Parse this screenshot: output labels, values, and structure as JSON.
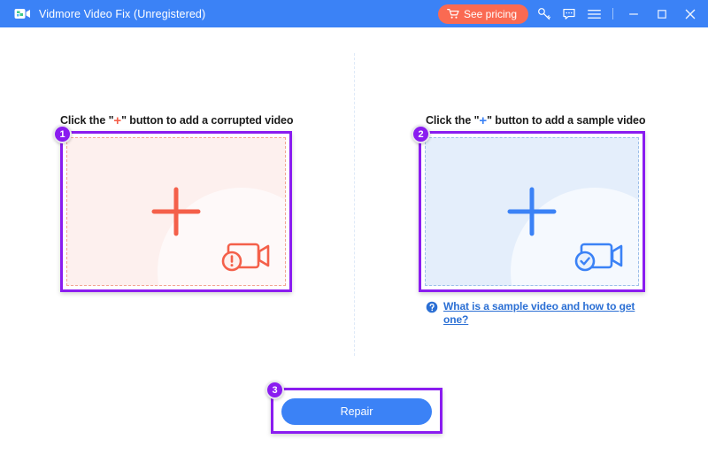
{
  "window": {
    "title": "Vidmore Video Fix (Unregistered)",
    "logo_icon": "video-camera-logo-icon",
    "accent_blue": "#3b82f6",
    "accent_purple": "#8a1cf0",
    "accent_coral": "#fa6a52"
  },
  "toolbar": {
    "pricing_label": "See pricing",
    "pricing_icon": "shopping-cart-icon",
    "key_icon": "key-icon",
    "feedback_icon": "speech-bubble-icon",
    "menu_icon": "hamburger-menu-icon",
    "minimize_icon": "minimize-icon",
    "maximize_icon": "maximize-icon",
    "close_icon": "close-icon"
  },
  "panels": {
    "left": {
      "badge": "1",
      "label_before": "Click the \"",
      "label_plus": "+",
      "label_after": "\" button to add a corrupted video",
      "dropzone_icon": "video-camera-error-icon",
      "plus_icon": "plus-icon",
      "plus_color": "#f4604a"
    },
    "right": {
      "badge": "2",
      "label_before": "Click the \"",
      "label_plus": "+",
      "label_after": "\" button to add a sample video",
      "dropzone_icon": "video-camera-check-icon",
      "plus_icon": "plus-icon",
      "plus_color": "#3b82f6",
      "help_icon": "question-mark-icon",
      "help_text": "What is a sample video and how to get one?"
    }
  },
  "footer": {
    "badge": "3",
    "repair_label": "Repair"
  }
}
